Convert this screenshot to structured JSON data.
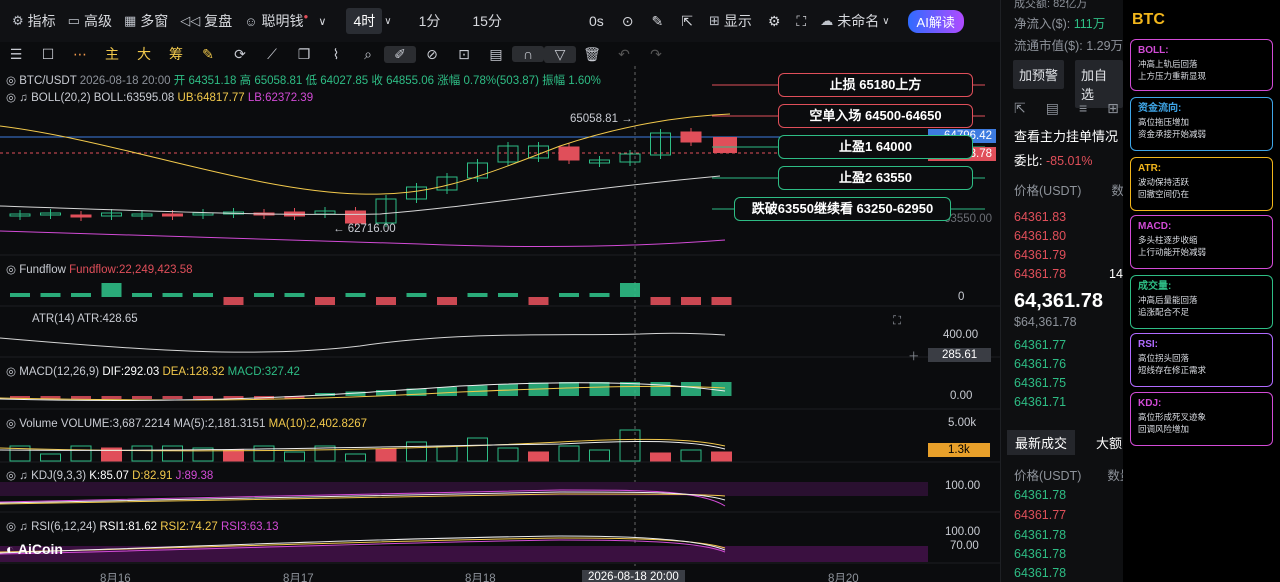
{
  "toolbar": {
    "indicators": "指标",
    "advanced": "高级",
    "multi_window": "多窗",
    "replay": "复盘",
    "smart_money": "聪明钱",
    "timeframes": [
      "4时",
      "1分",
      "15分"
    ],
    "active_tf": "4时",
    "zero_s": "0s",
    "display": "显示",
    "layout_name": "未命名",
    "ai": "AI解读"
  },
  "draw_tools": [
    "主",
    "大",
    "筹"
  ],
  "chart": {
    "pair_line": {
      "pair": "BTC/USDT",
      "time": "2026-08-18 20:00",
      "open": "开 64351.18",
      "high": "高 65058.81",
      "low": "低 64027.85",
      "close": "收 64855.06",
      "change": "涨幅 0.78%(503.87)",
      "amp": "振幅 1.60%"
    },
    "boll": {
      "name": "BOLL(20,2)",
      "mid": "BOLL:63595.08",
      "ub": "UB:64817.77",
      "lb": "LB:62372.39"
    },
    "annot_high": "65058.81",
    "annot_low": "62716.00",
    "fundflow": {
      "name": "Fundflow",
      "val": "Fundflow:22,249,423.58",
      "axis": "0"
    },
    "atr": {
      "name": "ATR(14)",
      "val": "ATR:428.65",
      "axis1": "400.00",
      "axis2": "285.61"
    },
    "macd": {
      "name": "MACD(12,26,9)",
      "dif": "DIF:292.03",
      "dea": "DEA:128.32",
      "macd": "MACD:327.42",
      "axis": "0.00"
    },
    "volume": {
      "name": "Volume",
      "vol": "VOLUME:3,687.2214",
      "ma5": "MA(5):2,181.3151",
      "ma10": "MA(10):2,402.8267",
      "axis1": "5.00k",
      "axis2": "1.3k"
    },
    "kdj": {
      "name": "KDJ(9,3,3)",
      "k": "K:85.07",
      "d": "D:82.91",
      "j": "J:89.38",
      "axis": "100.00"
    },
    "rsi": {
      "name": "RSI(6,12,24)",
      "r1": "RSI1:81.62",
      "r2": "RSI2:74.27",
      "r3": "RSI3:63.13",
      "axis1": "100.00",
      "axis2": "70.00"
    },
    "xaxis": [
      "8月16",
      "8月17",
      "8月18",
      "2026-08-18 20:00",
      "8月20"
    ],
    "logo": "AiCoin",
    "price_tags": [
      {
        "text": "64796.42",
        "color": "#3d7be0"
      },
      {
        "text": "64383.78",
        "color": "#e04f5a"
      },
      {
        "text": "63550.00",
        "color": "#6b6e75"
      }
    ],
    "pills": [
      {
        "text": "止损 65180上方",
        "kind": "red"
      },
      {
        "text": "空单入场 64500-64650",
        "kind": "red"
      },
      {
        "text": "止盈1 64000",
        "kind": "green"
      },
      {
        "text": "止盈2 63550",
        "kind": "green"
      },
      {
        "text": "跌破63550继续看 63250-62950",
        "kind": "green"
      }
    ]
  },
  "market": {
    "top_partial": "成交额: 82亿万",
    "inflow": "净流入($): ",
    "inflow_val": "111万",
    "mcap": "流通市值($): 1.29万",
    "alert_btn": "加预警",
    "watch_btn": "加自选",
    "depth_title": "查看主力挂单情况",
    "ratio_label": "委比:",
    "ratio": "-85.01%",
    "price_hdr": "价格(USDT)",
    "qty_hdr": "数",
    "asks": [
      "64361.83",
      "64361.80",
      "64361.79",
      "64361.78"
    ],
    "ask_qty": "14",
    "last": "64,361.78",
    "last_usd": "$64,361.78",
    "bids": [
      "64361.77",
      "64361.76",
      "64361.75",
      "64361.71"
    ],
    "trades_tab": "最新成交",
    "big_tab": "大额",
    "trades_price_hdr": "价格(USDT)",
    "trades_qty_hdr": "数量(",
    "trades": [
      {
        "p": "64361.78",
        "c": "g"
      },
      {
        "p": "64361.77",
        "c": "r"
      },
      {
        "p": "64361.78",
        "c": "g"
      },
      {
        "p": "64361.78",
        "c": "g"
      },
      {
        "p": "64361.78",
        "c": "g"
      }
    ]
  },
  "side": {
    "title": "BTC",
    "cards": [
      {
        "t": "BOLL:",
        "l1": "冲高上轨后回落",
        "l2": "上方压力重新显现",
        "c": "#d24bd6"
      },
      {
        "t": "资金流向:",
        "l1": "高位拖压增加",
        "l2": "资金承接开始减弱",
        "c": "#3fa6e8"
      },
      {
        "t": "ATR:",
        "l1": "波动保持活跃",
        "l2": "回撤空间仍在",
        "c": "#f2b61c"
      },
      {
        "t": "MACD:",
        "l1": "多头柱逐步收缩",
        "l2": "上行动能开始减弱",
        "c": "#d24bd6"
      },
      {
        "t": "成交量:",
        "l1": "冲高后量能回落",
        "l2": "追涨配合不足",
        "c": "#2ebd85"
      },
      {
        "t": "RSI:",
        "l1": "高位拐头回落",
        "l2": "短线存在修正需求",
        "c": "#b06bff"
      },
      {
        "t": "KDJ:",
        "l1": "高位形成死叉迹象",
        "l2": "回调风险增加",
        "c": "#d24bd6"
      }
    ]
  }
}
